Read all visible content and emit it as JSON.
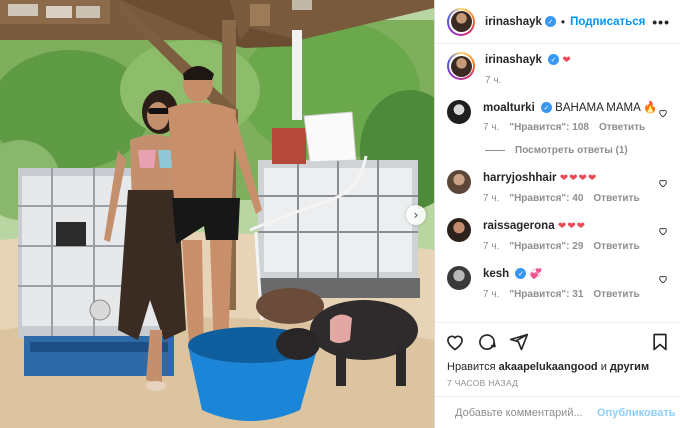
{
  "post": {
    "username": "irinashayk",
    "follow_label": "Подписаться",
    "more_label": "•••",
    "next_arrow": "›"
  },
  "caption": {
    "username": "irinashayk",
    "text": "❤",
    "time": "7 ч."
  },
  "comments": [
    {
      "username": "moalturki",
      "verified": true,
      "text": "BAHAMA MAMA 🔥",
      "time": "7 ч.",
      "likes": "\"Нравится\": 108",
      "reply": "Ответить"
    },
    {
      "username": "harryjoshhair",
      "verified": false,
      "text": "❤❤❤❤",
      "time": "7 ч.",
      "likes": "\"Нравится\": 40",
      "reply": "Ответить"
    },
    {
      "username": "raissagerona",
      "verified": false,
      "text": "❤❤❤",
      "time": "7 ч.",
      "likes": "\"Нравится\": 29",
      "reply": "Ответить"
    },
    {
      "username": "kesh",
      "verified": true,
      "text": "💞",
      "time": "7 ч.",
      "likes": "\"Нравится\": 31",
      "reply": "Ответить"
    }
  ],
  "view_replies": "Посмотреть ответы (1)",
  "likes_line": {
    "prefix": "Нравится ",
    "user": "akaapelukaangood",
    "middle": " и ",
    "others": "другим"
  },
  "posted_ago": "7 ЧАСОВ НАЗАД",
  "comment_box": {
    "placeholder": "Добавьте комментарий...",
    "submit_label": "Опубликовать"
  },
  "icons": [
    "like-icon",
    "comment-icon",
    "share-icon",
    "save-icon",
    "emoji-icon",
    "verified-icon",
    "heart-small-icon"
  ],
  "colors": {
    "accent": "#0095f6",
    "verified": "#3897f0",
    "heart": "#ed4956",
    "muted": "#8e8e8e"
  }
}
